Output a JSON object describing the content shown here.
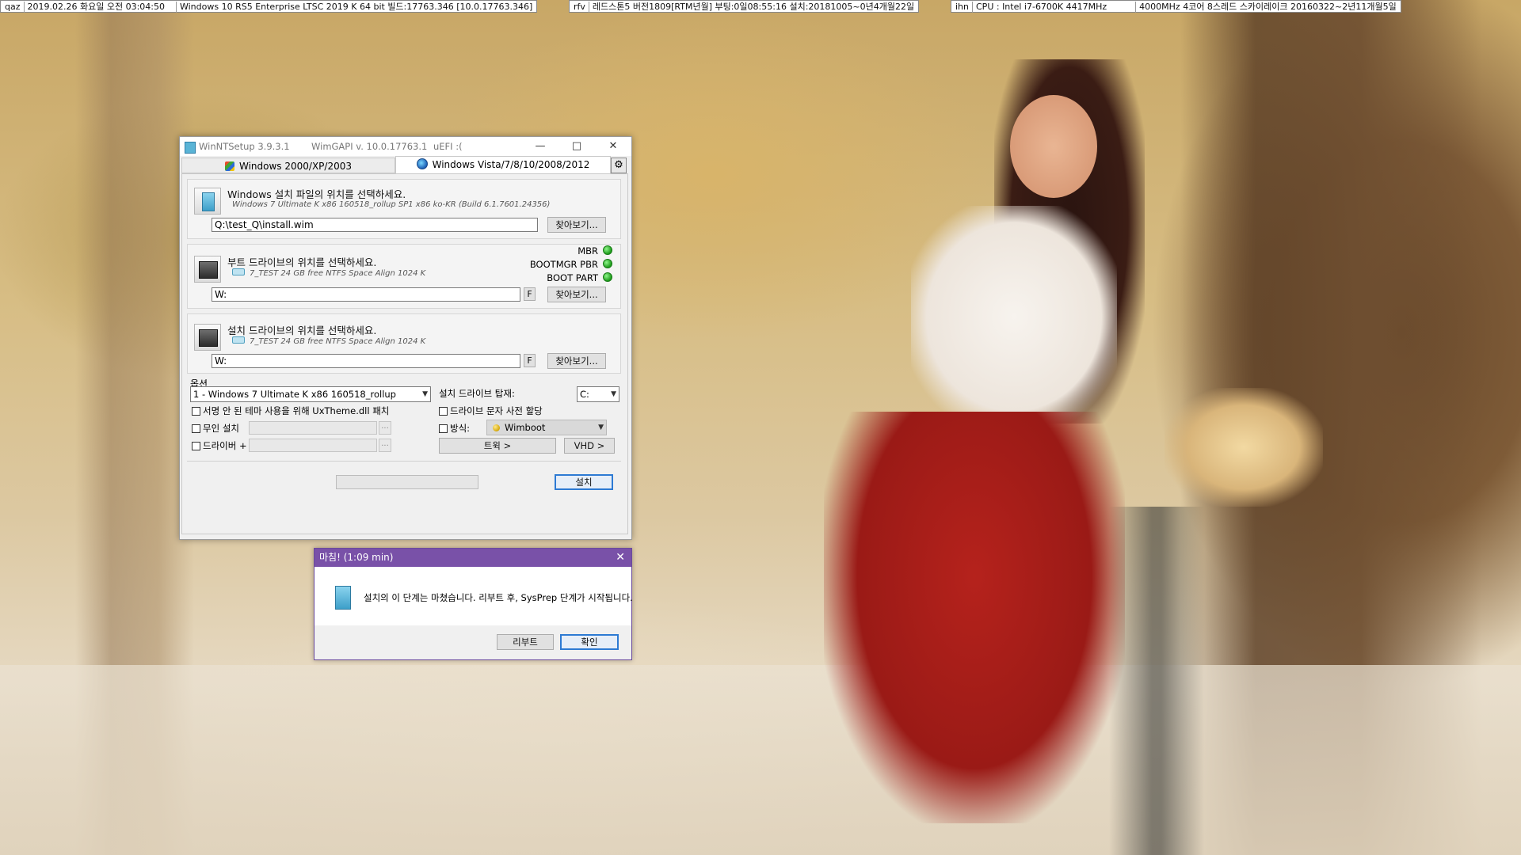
{
  "infobar": {
    "items": [
      [
        "qaz",
        "2019.02.26 화요일 오전 03:04:50",
        "Windows 10 RS5 Enterprise LTSC 2019 K 64 bit 빌드:17763.346 [10.0.17763.346]"
      ],
      [
        "rfv",
        "레드스톤5 버전1809[RTM년월] 부팅:0일08:55:16 설치:20181005~0년4개월22일"
      ],
      [
        "ihn",
        "CPU : Intel i7-6700K 4417MHz",
        "4000MHz 4코어 8스레드 스카이레이크 20160322~2년11개월5일"
      ]
    ]
  },
  "window": {
    "app_title": "WinNTSetup 3.9.3.1",
    "wimgapi": "WimGAPI v. 10.0.17763.1",
    "uefi": "uEFI :(",
    "minimize": "—",
    "maximize": "□",
    "close": "✕",
    "tabs": [
      "Windows 2000/XP/2003",
      "Windows Vista/7/8/10/2008/2012"
    ],
    "gear": "⚙",
    "source": {
      "title": "Windows 설치 파일의 위치를 선택하세요.",
      "subtitle": "Windows 7 Ultimate K x86 160518_rollup SP1 x86 ko-KR (Build 6.1.7601.24356)",
      "path": "Q:\\test_Q\\install.wim",
      "browse": "찾아보기..."
    },
    "boot": {
      "title": "부트 드라이브의 위치를 선택하세요.",
      "subtitle": "7_TEST 24 GB free NTFS Space Align 1024 K",
      "path": "W:",
      "f": "F",
      "browse": "찾아보기...",
      "status": [
        "MBR",
        "BOOTMGR PBR",
        "BOOT PART"
      ]
    },
    "install": {
      "title": "설치 드라이브의 위치를 선택하세요.",
      "subtitle": "7_TEST 24 GB free NTFS Space Align 1024 K",
      "path": "W:",
      "f": "F",
      "browse": "찾아보기..."
    },
    "options": {
      "label": "옵션",
      "edition": "1 - Windows 7 Ultimate K x86 160518_rollup",
      "mount_label": "설치 드라이브 탑재:",
      "mount_value": "C:",
      "uxtheme": "서명 안 된 테마 사용을 위해 UxTheme.dll 패치",
      "prealloc": "드라이브 문자 사전 할당",
      "unattended": "무인 설치",
      "mode_label": "방식:",
      "mode_value": "Wimboot",
      "drivers": "드라이버 +",
      "dots": "...",
      "tweaks": "트윅 >",
      "vhd": "VHD >",
      "setup": "설치"
    }
  },
  "dialog": {
    "title": "마침! (1:09 min)",
    "close": "✕",
    "message": "설치의 이 단계는 마쳤습니다. 리부트 후, SysPrep 단계가 시작됩니다.",
    "reboot": "리부트",
    "ok": "확인"
  }
}
